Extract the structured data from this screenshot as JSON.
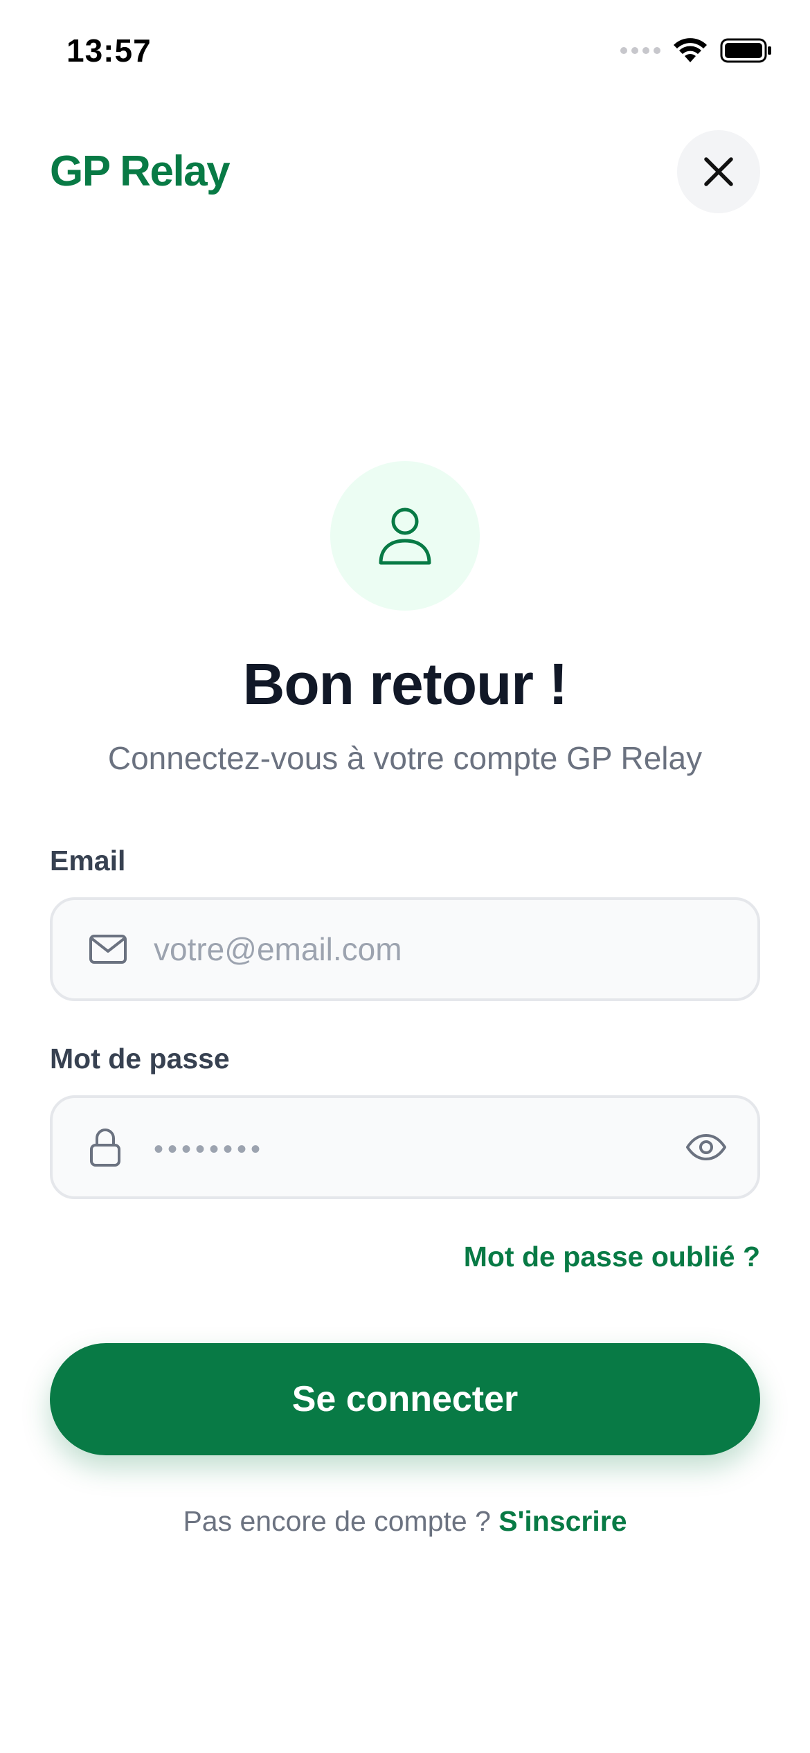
{
  "status_bar": {
    "time": "13:57"
  },
  "header": {
    "brand": "GP Relay"
  },
  "hero": {
    "title": "Bon retour !",
    "subtitle": "Connectez-vous à votre compte GP Relay"
  },
  "form": {
    "email_label": "Email",
    "email_placeholder": "votre@email.com",
    "password_label": "Mot de passe",
    "password_placeholder": "••••••••",
    "forgot_password": "Mot de passe oublié ?",
    "submit_label": "Se connecter"
  },
  "footer": {
    "prompt": "Pas encore de compte ?",
    "signup_label": "S'inscrire"
  },
  "colors": {
    "brand": "#087A45",
    "avatar_bg": "#ECFDF3",
    "field_bg": "#F9FAFB",
    "field_border": "#E5E7EB",
    "title": "#111827",
    "muted": "#6B7280"
  },
  "icons": {
    "status": [
      "signal-icon",
      "wifi-icon",
      "battery-icon"
    ],
    "close": "close-icon",
    "avatar": "user-icon",
    "email": "mail-icon",
    "password": "lock-icon",
    "toggle": "eye-icon"
  }
}
